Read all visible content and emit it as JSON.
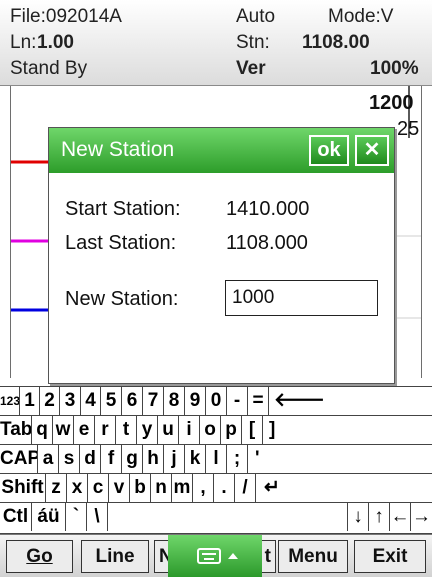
{
  "status": {
    "file": "File:092014A",
    "auto": "Auto",
    "mode": "Mode:V",
    "line_label": "Ln:",
    "line_value": "1.00",
    "stn_label": "Stn:",
    "stn_value": "1108.00",
    "state": "Stand By",
    "ver": "Ver",
    "percent": "100%"
  },
  "graph": {
    "scale_top": "1200",
    "scale_second": "25"
  },
  "dialog": {
    "title": "New Station",
    "ok_label": "ok",
    "close_label": "✕",
    "start_label": "Start Station:",
    "start_value": "1410.000",
    "last_label": "Last  Station:",
    "last_value": "1108.000",
    "new_label": "New  Station:",
    "new_value": "1000"
  },
  "keyboard": {
    "rows": [
      [
        "123",
        "1",
        "2",
        "3",
        "4",
        "5",
        "6",
        "7",
        "8",
        "9",
        "0",
        "-",
        "=",
        "🡐"
      ],
      [
        "Tab",
        "q",
        "w",
        "e",
        "r",
        "t",
        "y",
        "u",
        "i",
        "o",
        "p",
        "[",
        "]"
      ],
      [
        "CAP",
        "a",
        "s",
        "d",
        "f",
        "g",
        "h",
        "j",
        "k",
        "l",
        ";",
        "'"
      ],
      [
        "Shift",
        "z",
        "x",
        "c",
        "v",
        "b",
        "n",
        "m",
        ",",
        ".",
        "/",
        "↵"
      ],
      [
        "Ctl",
        "áü",
        "`",
        "\\",
        "",
        "↓",
        "↑",
        "←",
        "→"
      ]
    ]
  },
  "menu": {
    "go": "Go",
    "line": "Line",
    "n_partial": "N",
    "t_partial": "t",
    "menu": "Menu",
    "exit": "Exit",
    "sip_icon": "keyboard-icon"
  },
  "colors": {
    "accent_green": "#3aae37",
    "red_line": "#e00000",
    "magenta_line": "#e000e0",
    "blue_line": "#0000e0",
    "green_line": "#22cc22"
  }
}
